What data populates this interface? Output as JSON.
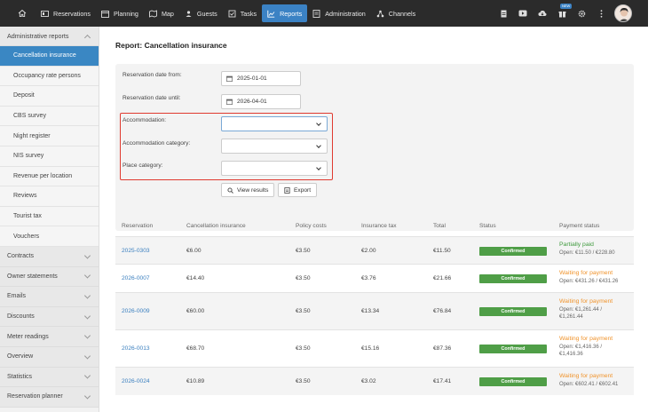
{
  "nav": {
    "items": [
      {
        "label": "Reservations",
        "icon": "reservations-icon"
      },
      {
        "label": "Planning",
        "icon": "planning-icon"
      },
      {
        "label": "Map",
        "icon": "map-icon"
      },
      {
        "label": "Guests",
        "icon": "guests-icon"
      },
      {
        "label": "Tasks",
        "icon": "tasks-icon"
      },
      {
        "label": "Reports",
        "icon": "reports-icon",
        "active": true
      },
      {
        "label": "Administration",
        "icon": "administration-icon"
      },
      {
        "label": "Channels",
        "icon": "channels-icon"
      }
    ],
    "gift_badge": "NEW",
    "accent": "#3b82c4"
  },
  "sidebar": {
    "section": "Administrative reports",
    "subitems": [
      "Cancellation insurance",
      "Occupancy rate persons",
      "Deposit",
      "CBS survey",
      "Night register",
      "NIS survey",
      "Revenue per location",
      "Reviews",
      "Tourist tax",
      "Vouchers"
    ],
    "items": [
      "Contracts",
      "Owner statements",
      "Emails",
      "Discounts",
      "Meter readings",
      "Overview",
      "Statistics",
      "Reservation planner"
    ]
  },
  "page": {
    "title": "Report: Cancellation insurance"
  },
  "filters": {
    "date_from_label": "Reservation date from:",
    "date_from_value": "2025-01-01",
    "date_until_label": "Reservation date until:",
    "date_until_value": "2026-04-01",
    "accommodation_label": "Accommodation:",
    "accommodation_category_label": "Accommodation category:",
    "place_category_label": "Place category:",
    "view_results_label": "View results",
    "export_label": "Export"
  },
  "table": {
    "headers": [
      "Reservation",
      "Cancellation insurance",
      "Policy costs",
      "Insurance tax",
      "Total",
      "Status",
      "Payment status"
    ],
    "rows": [
      {
        "reservation": "2025-0303",
        "insurance": "€6.00",
        "policy": "€3.50",
        "tax": "€2.00",
        "total": "€11.50",
        "status": "Confirmed",
        "pay_title": "Partially paid",
        "pay_kind": "green",
        "pay_open": "Open: €11.50 / €228.80"
      },
      {
        "reservation": "2026-0007",
        "insurance": "€14.40",
        "policy": "€3.50",
        "tax": "€3.76",
        "total": "€21.66",
        "status": "Confirmed",
        "pay_title": "Waiting for payment",
        "pay_kind": "orange",
        "pay_open": "Open: €431.26 / €431.26"
      },
      {
        "reservation": "2026-0009",
        "insurance": "€60.00",
        "policy": "€3.50",
        "tax": "€13.34",
        "total": "€76.84",
        "status": "Confirmed",
        "pay_title": "Waiting for payment",
        "pay_kind": "orange",
        "pay_open": "Open: €1,261.44 / €1,261.44"
      },
      {
        "reservation": "2026-0013",
        "insurance": "€68.70",
        "policy": "€3.50",
        "tax": "€15.16",
        "total": "€87.36",
        "status": "Confirmed",
        "pay_title": "Waiting for payment",
        "pay_kind": "orange",
        "pay_open": "Open: €1,416.36 / €1,416.36"
      },
      {
        "reservation": "2026-0024",
        "insurance": "€10.89",
        "policy": "€3.50",
        "tax": "€3.02",
        "total": "€17.41",
        "status": "Confirmed",
        "pay_title": "Waiting for payment",
        "pay_kind": "orange",
        "pay_open": "Open: €602.41 / €602.41"
      }
    ],
    "status_color": "#4f9e47"
  }
}
